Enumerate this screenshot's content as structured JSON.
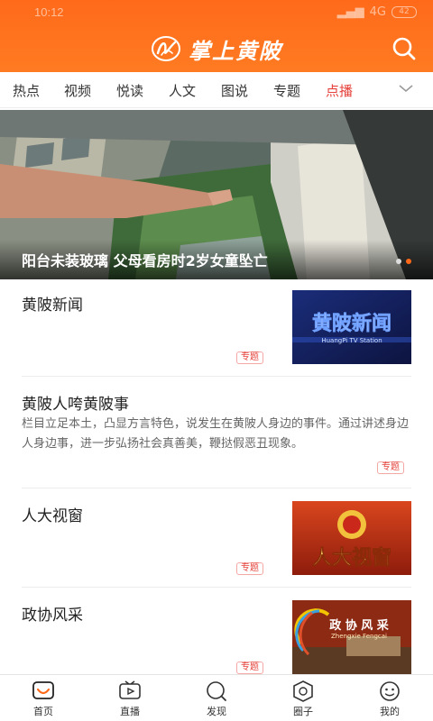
{
  "status_bar": {
    "time": "10:12",
    "network": "4G",
    "battery": "42"
  },
  "header": {
    "title": "掌上黄陂",
    "bg_color": "#ff6a1a"
  },
  "tabs": [
    {
      "label": "热点",
      "active": false
    },
    {
      "label": "视频",
      "active": false
    },
    {
      "label": "悦读",
      "active": false
    },
    {
      "label": "人文",
      "active": false
    },
    {
      "label": "图说",
      "active": false
    },
    {
      "label": "专题",
      "active": false
    },
    {
      "label": "点播",
      "active": true
    }
  ],
  "banner": {
    "caption": "阳台未装玻璃 父母看房时2岁女童坠亡",
    "slide_count": 2,
    "active_slide": 2
  },
  "articles": [
    {
      "title": "黄陂新闻",
      "tag": "专题",
      "thumb_text": "黄陂新闻",
      "thumb_sub": "HuangPi TV Station"
    },
    {
      "title": "黄陂人咵黄陂事",
      "desc": "栏目立足本土，凸显方言特色，说发生在黄陂人身边的事件。通过讲述身边人身边事，进一步弘扬社会真善美，鞭挞假恶丑现象。",
      "tag": "专题"
    },
    {
      "title": "人大视窗",
      "tag": "专题",
      "thumb_text": "人大视窗"
    },
    {
      "title": "政协风采",
      "tag": "专题",
      "thumb_text": "政 协 风 采",
      "thumb_sub": "Zhengxie Fengcai"
    }
  ],
  "bottom_nav": [
    {
      "label": "首页",
      "icon": "home-icon",
      "active": true
    },
    {
      "label": "直播",
      "icon": "tv-icon",
      "active": false
    },
    {
      "label": "发现",
      "icon": "discover-icon",
      "active": false
    },
    {
      "label": "圈子",
      "icon": "circle-icon",
      "active": false
    },
    {
      "label": "我的",
      "icon": "profile-icon",
      "active": false
    }
  ],
  "colors": {
    "accent": "#ff6a1a",
    "active_tab": "#e5413a",
    "tag": "#e5413a"
  }
}
